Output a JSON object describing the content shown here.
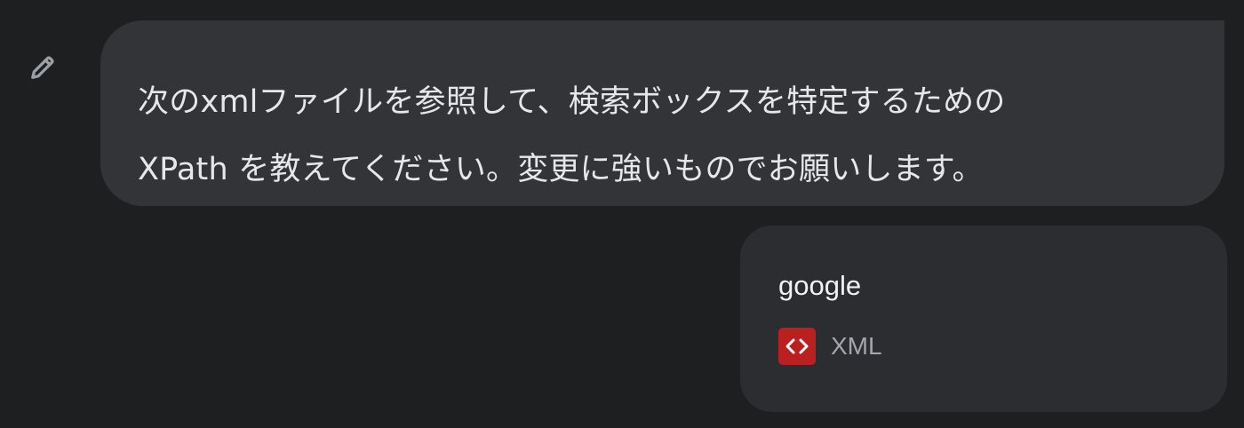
{
  "prompt": {
    "lines": [
      "次のxmlファイルを参照して、検索ボックスを特定するための",
      "XPath を教えてください。変更に強いものでお願いします。"
    ]
  },
  "attachment": {
    "file_name": "google",
    "file_type": "XML",
    "icon": "xml-file-icon",
    "icon_color": "#b9201f"
  },
  "edit": {
    "icon": "pencil-icon"
  },
  "colors": {
    "background": "#1e1f21",
    "bubble": "#333437",
    "card": "#2c2d30"
  }
}
